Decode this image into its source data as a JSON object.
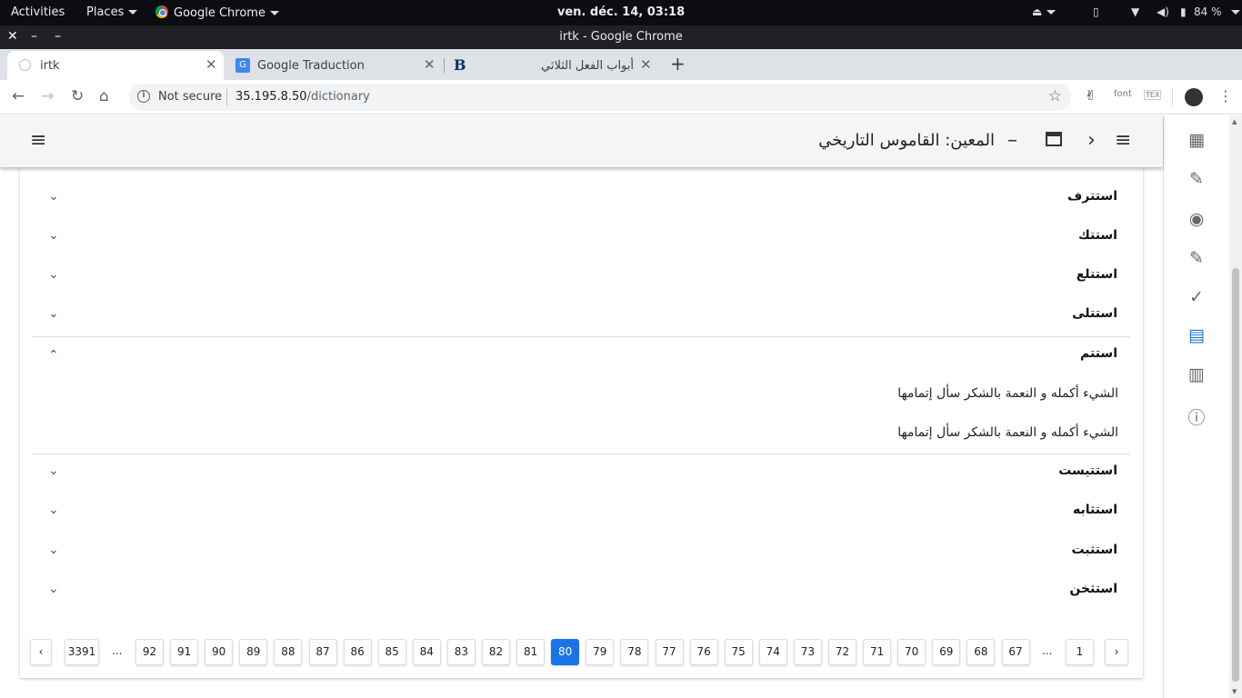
{
  "os": {
    "activities": "Activities",
    "places": "Places",
    "app_menu": "Google Chrome",
    "clock": "ven. déc. 14, 03:18",
    "battery": "84 %"
  },
  "window": {
    "title": "irtk - Google Chrome"
  },
  "tabs": [
    {
      "label": "irtk"
    },
    {
      "label": "Google Traduction"
    },
    {
      "label": "أبواب الفعل الثلاثي"
    }
  ],
  "toolbar": {
    "security": "Not secure",
    "url_host": "35.195.8.50",
    "url_path": "/dictionary",
    "ext_font": "font"
  },
  "app": {
    "title": "المعين: القاموس التاريخي"
  },
  "entries": [
    {
      "word": "استترف"
    },
    {
      "word": "استتك"
    },
    {
      "word": "استتلع"
    },
    {
      "word": "استتلى"
    },
    {
      "word": "استتم",
      "expanded": true,
      "definitions": [
        "الشيء أكمله و النعمة بالشكر سأل إتمامها",
        "الشيء أكمله و النعمة بالشكر سأل إتمامها"
      ]
    },
    {
      "word": "استتيست"
    },
    {
      "word": "استثابه"
    },
    {
      "word": "استثبت"
    },
    {
      "word": "استثخن"
    }
  ],
  "pagination": {
    "current": "80",
    "last": "3391",
    "first": "1",
    "ellipsis": "...",
    "pages": [
      "92",
      "91",
      "90",
      "89",
      "88",
      "87",
      "86",
      "85",
      "84",
      "83",
      "82",
      "81",
      "80",
      "79",
      "78",
      "77",
      "76",
      "75",
      "74",
      "73",
      "72",
      "71",
      "70",
      "69",
      "68",
      "67"
    ]
  }
}
